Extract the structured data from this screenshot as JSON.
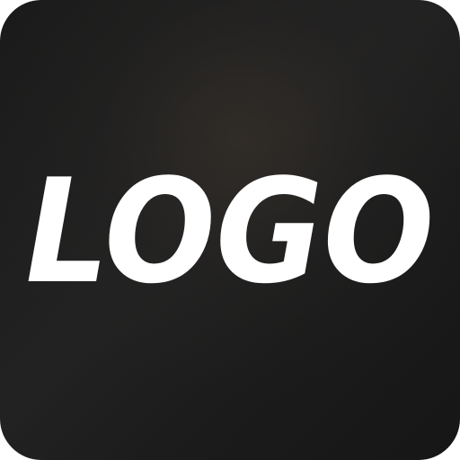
{
  "logo": {
    "text": "LOGO"
  },
  "colors": {
    "background": "#1d1d1d",
    "logo_text": "#ffffff"
  }
}
